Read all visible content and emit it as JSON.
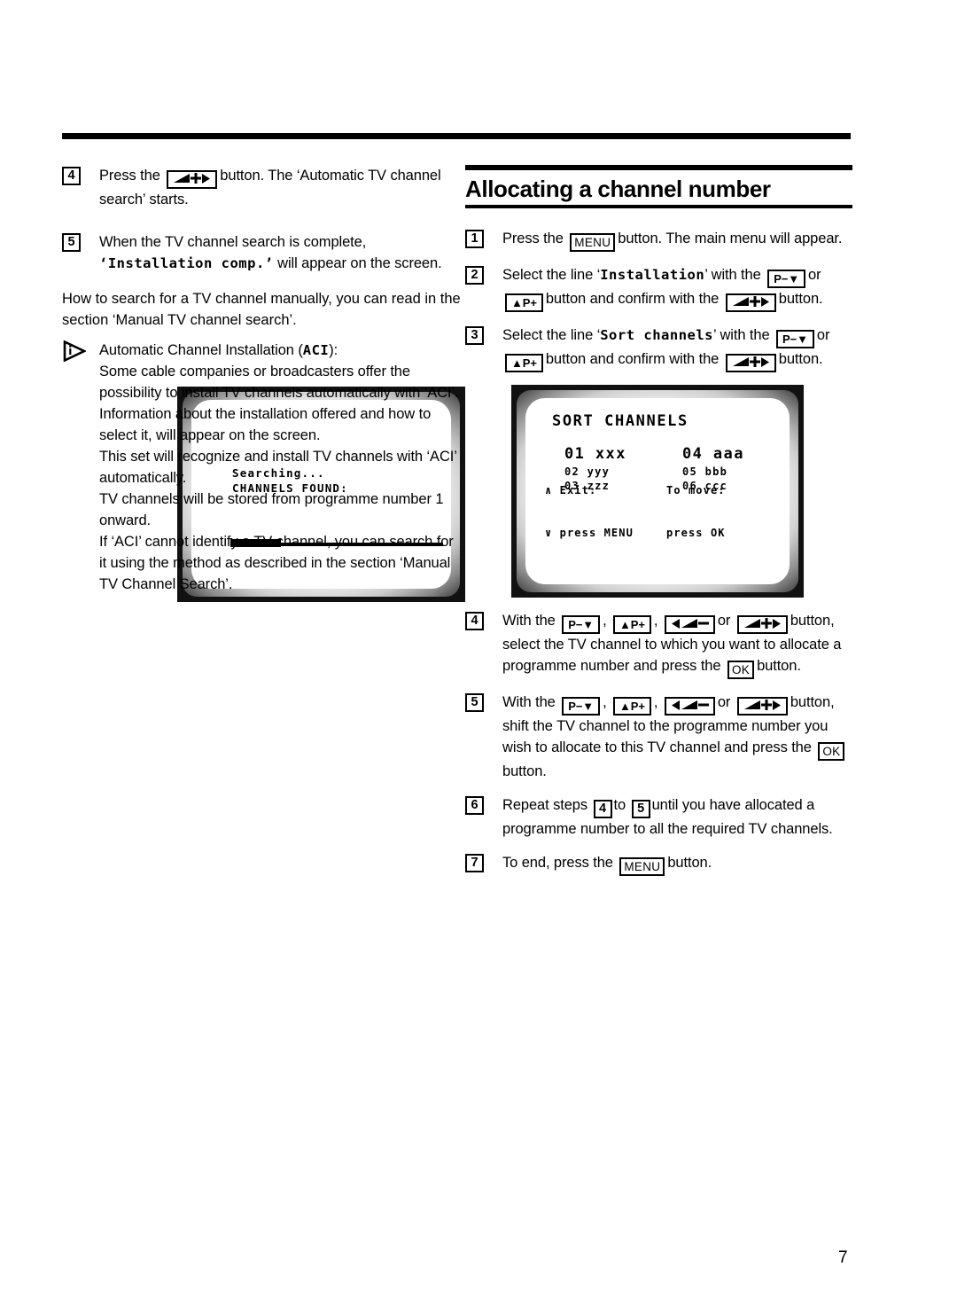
{
  "page": {
    "number": "7"
  },
  "left_column": {
    "step4": {
      "num": "4",
      "text_before": "Press the",
      "key": "volume-up",
      "text_after": "button. The ‘Automatic TV channel search’ starts."
    },
    "tv_search_screen": {
      "line1": "Searching...",
      "line2": "CHANNELS FOUND:",
      "progress_percent": 24
    },
    "step5": {
      "num": "5",
      "text_before": "When the TV channel search is complete,",
      "osd": "‘Installation comp.’",
      "text_after": "will appear on the screen."
    },
    "manual_note": "How to search for a TV channel manually, you can read in the section ‘Manual TV channel search’.",
    "tip": {
      "icon": "info-triangle-icon",
      "heading_before": "Automatic Channel Installation (",
      "heading_osd": "ACI",
      "heading_after": "):",
      "lines": [
        "Some cable companies or broadcasters offer the possibility to install TV channels automatically with ‘ACI’. Information about the installation offered and how to select it, will appear on the screen.",
        "This set will recognize and install TV channels with ‘ACI’ automatically.",
        "TV channels will be stored from programme number 1 onward.",
        "If ‘ACI’ cannot identify a TV channel, you can search for it using the method as described in the section ‘Manual TV Channel Search’."
      ]
    }
  },
  "right_column": {
    "section_title": "Allocating a channel number",
    "step1": {
      "num": "1",
      "text_before": "Press the",
      "key": "MENU",
      "text_after": "button. The main menu will appear."
    },
    "step2": {
      "num": "2",
      "text_a": "Select the line ‘",
      "osd": "Installation",
      "text_b": "’ with the",
      "key1": "P−▼",
      "text_c": "or",
      "key2": "▲P+",
      "text_d": "button and confirm with the",
      "key3": "volume-up",
      "text_e": "button."
    },
    "step3": {
      "num": "3",
      "text_a": "Select the line ‘",
      "osd": "Sort channels",
      "text_b": "’ with the",
      "key1": "P−▼",
      "text_c": "or",
      "key2": "▲P+",
      "text_d": "button and confirm with the",
      "key3": "volume-up",
      "text_e": "button."
    },
    "tv_sort_screen": {
      "title": "SORT CHANNELS",
      "column1": [
        {
          "number": "01",
          "name": "xxx",
          "highlighted": true
        },
        {
          "number": "02",
          "name": "yyy",
          "highlighted": false
        },
        {
          "number": "03",
          "name": "zzz",
          "highlighted": false
        }
      ],
      "column2": [
        {
          "number": "04",
          "name": "aaa",
          "highlighted": true
        },
        {
          "number": "05",
          "name": "bbb",
          "highlighted": false
        },
        {
          "number": "06",
          "name": "ccc",
          "highlighted": false
        }
      ],
      "footer": {
        "left_line1": "∧ Exit:",
        "left_line2": "∨ press MENU",
        "right_line1": "To move:",
        "right_line2": "press OK"
      }
    },
    "step4": {
      "num": "4",
      "text_a": "With the",
      "key1": "P−▼",
      "sep1": ",",
      "key2": "▲P+",
      "sep2": ",",
      "key3": "volume-down",
      "text_b": "or",
      "key4": "volume-up",
      "text_c": "button, select the TV channel to which you want to allocate a programme number and press the",
      "key5": "OK",
      "text_d": "button."
    },
    "step5": {
      "num": "5",
      "text_a": "With the",
      "key1": "P−▼",
      "sep1": ",",
      "key2": "▲P+",
      "sep2": ",",
      "key3": "volume-down",
      "text_b": "or",
      "key4": "volume-up",
      "text_c": "button, shift the TV channel to the programme number you wish to allocate to this TV channel and press the",
      "key5": "OK",
      "text_d": "button."
    },
    "step6": {
      "num": "6",
      "text_a": "Repeat steps",
      "ref1": "4",
      "text_b": "to",
      "ref2": "5",
      "text_c": "until you have allocated a programme number to all the required TV channels."
    },
    "step7": {
      "num": "7",
      "text_a": "To end, press the",
      "key": "MENU",
      "text_b": "button."
    }
  },
  "keycaps": {
    "menu_label": "MENU",
    "ok_label": "OK",
    "p_down_label": "P−▼",
    "p_up_label": "▲P+"
  }
}
